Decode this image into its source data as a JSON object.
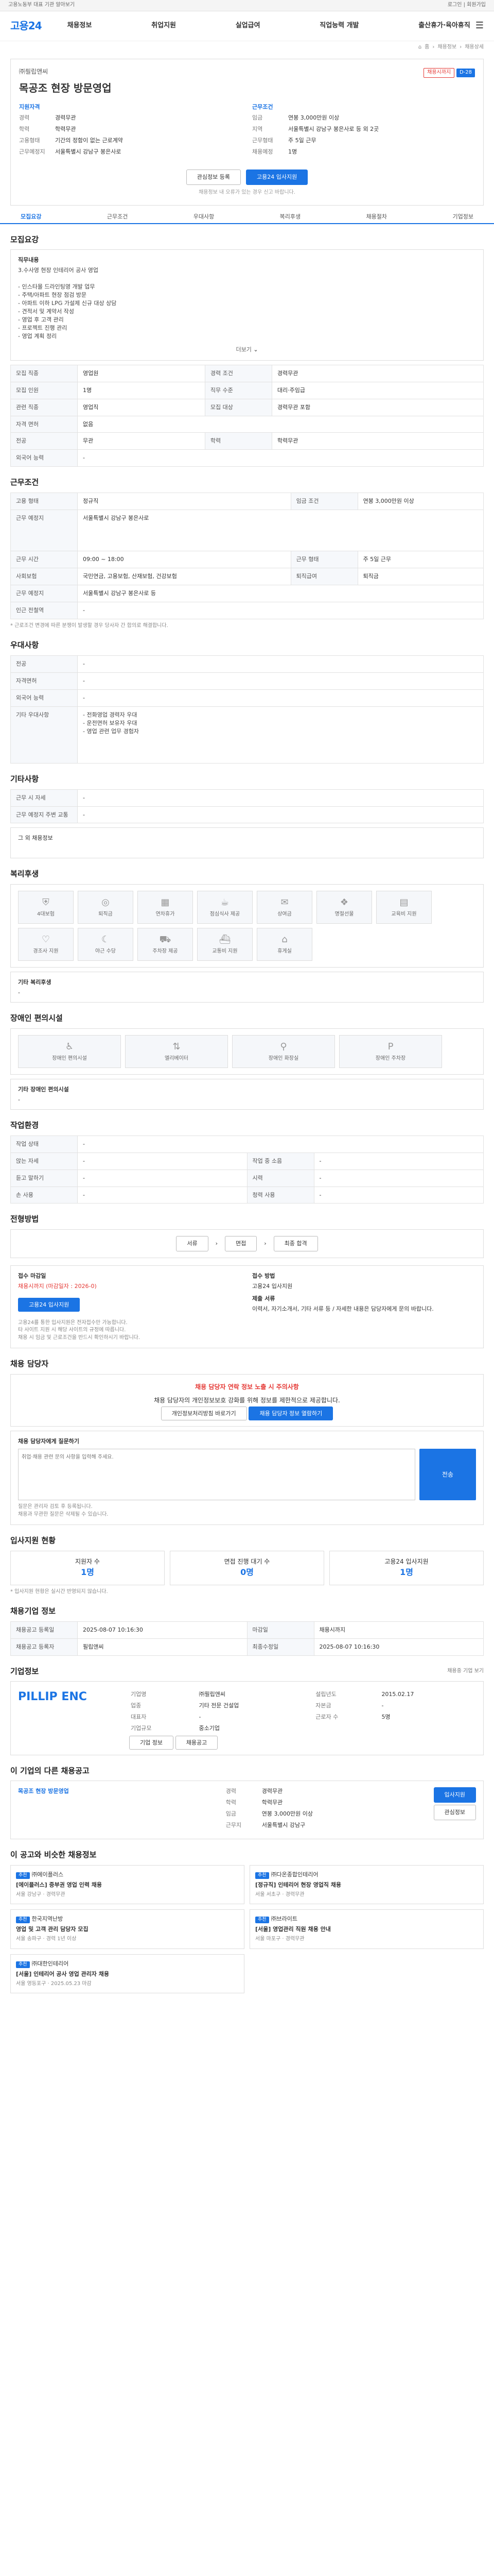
{
  "topbar": {
    "left": "고용노동부 대표 기관 알아보기",
    "right": "로그인 | 회원가입"
  },
  "logo": {
    "text": "고용24"
  },
  "gnb": [
    "채용정보",
    "취업지원",
    "실업급여",
    "직업능력 개발",
    "출산휴가·육아휴직"
  ],
  "breadcrumb": [
    "홈",
    "채용정보",
    "채용상세"
  ],
  "tabs": [
    "모집요강",
    "근무조건",
    "우대사항",
    "복리후생",
    "채용절차",
    "기업정보"
  ],
  "job": {
    "badge_dday": "D-28",
    "badge_status": "채용시까지",
    "company": "㈜필립앤씨",
    "title": "목공조 현장 방문영업",
    "summary_left_head": "지원자격",
    "summary_right_head": "근무조건",
    "left": [
      {
        "k": "경력",
        "v": "경력무관"
      },
      {
        "k": "학력",
        "v": "학력무관"
      },
      {
        "k": "고용형태",
        "v": "기간의 정함이 없는 근로계약"
      },
      {
        "k": "근무예정지",
        "v": "서울특별시 강남구 봉은사로"
      }
    ],
    "right": [
      {
        "k": "임금",
        "v": "연봉 3,000만원 이상"
      },
      {
        "k": "지역",
        "v": "서울특별시 강남구 봉은사로 등 외 2곳"
      },
      {
        "k": "근무형태",
        "v": "주 5일 근무"
      },
      {
        "k": "채용예정",
        "v": "1명"
      }
    ],
    "btn_scrap": "관심정보 등록",
    "btn_apply": "고용24 입사지원",
    "notice": "채용정보 내 오류가 있는 경우 신고 바랍니다."
  },
  "recruit": {
    "head": "모집요강",
    "sub": "직무내용",
    "desc": "3.수사영 현장 인테리어 공사 영업\n\n- 인스타몰 드라인팅영 개발 업무\n- 주택/아파트 현장 점검 방문\n- 아파트 이하 LPG 가설제 신규 대상 상담\n- 견적서 및 계약서 작성\n- 영업 후 고객 관리\n- 프로젝트 진행 관리\n- 영업 계획 정리",
    "more": "더보기",
    "rows": [
      [
        "모집 직종",
        "영업원",
        "경력 조건",
        "경력무관"
      ],
      [
        "모집 인원",
        "1명",
        "직무 수준",
        "대리·주임급"
      ],
      [
        "관련 직종",
        "영업직",
        "모집 대상",
        "경력무관 포함"
      ],
      [
        "자격 면허",
        "없음",
        "",
        ""
      ],
      [
        "전공",
        "무관",
        "학력",
        "학력무관"
      ],
      [
        "외국어 능력",
        "-",
        "",
        ""
      ]
    ]
  },
  "work": {
    "head": "근무조건",
    "rows": [
      [
        "고용 형태",
        "정규직",
        "임금 조건",
        "연봉 3,000만원 이상"
      ],
      [
        "근무 예정지",
        "서울특별시 강남구 봉은사로",
        "",
        ""
      ],
      [
        "근무 시간",
        "09:00 ~ 18:00",
        "근무 형태",
        "주 5일 근무"
      ],
      [
        "사회보험",
        "국민연금, 고용보험, 산재보험, 건강보험",
        "퇴직급여",
        "퇴직금"
      ],
      [
        "근무 예정지",
        "서울특별시 강남구 봉은사로 등",
        "",
        ""
      ],
      [
        "인근 전철역",
        "-",
        "",
        ""
      ]
    ],
    "footnote": "* 근로조건 변경에 따른 분쟁이 발생할 경우 당사자 간 합의로 해결합니다."
  },
  "pref": {
    "head": "우대사항",
    "rows": [
      [
        "전공",
        "-"
      ],
      [
        "자격면허",
        "-"
      ],
      [
        "외국어 능력",
        "-"
      ],
      [
        "기타 우대사항",
        "- 전화영업 경력자 우대\n- 운전면허 보유자 우대\n- 영업 관련 업무 경험자"
      ]
    ]
  },
  "etc": {
    "head": "기타사항",
    "rows": [
      [
        "근무 시 자세",
        "-"
      ],
      [
        "근무 예정지 주변 교통",
        "-"
      ]
    ],
    "note": "그 외 채용정보"
  },
  "welfare": {
    "head": "복리후생",
    "items": [
      "4대보험",
      "퇴직금",
      "연차휴가",
      "점심식사 제공",
      "상여금",
      "명절선물",
      "교육비 지원",
      "경조사 지원",
      "야근 수당",
      "주차장 제공",
      "교통비 지원",
      "휴게실"
    ],
    "etc_label": "기타 복리후생",
    "etc_value": "-"
  },
  "disability": {
    "head": "장애인 편의시설",
    "items": [
      "장애인 편의시설",
      "엘리베이터",
      "장애인 화장실",
      "장애인 주차장"
    ],
    "etc_label": "기타 장애인 편의시설",
    "etc_value": "-"
  },
  "place": {
    "head": "작업환경",
    "rows": [
      [
        "작업 상태",
        "-",
        "",
        ""
      ],
      [
        "앉는 자세",
        "-",
        "작업 중 소음",
        "-"
      ],
      [
        "듣고 말하기",
        "-",
        "시력",
        "-"
      ],
      [
        "손 사용",
        "-",
        "청력 사용",
        "-"
      ]
    ]
  },
  "process": {
    "head": "전형방법",
    "steps": [
      "서류",
      "면접",
      "최종 합격"
    ]
  },
  "apply": {
    "head_doc": "접수 마감일",
    "deadline": "채용시까지 (마감일자 : 2026-0)",
    "head_method": "접수 방법",
    "method": "고용24 입사지원",
    "head_docs": "제출 서류",
    "docs": "이력서, 자기소개서, 기타 서류 등 / 자세한 내용은 담당자에게 문의 바랍니다.",
    "btn": "고용24 입사지원",
    "notes": [
      "고용24를 통한 입사지원은 전자접수만 가능합니다.",
      "타 사이트 지원 시 해당 사이트의 규정에 따릅니다.",
      "채용 시 임금 및 근로조건을 반드시 확인하시기 바랍니다."
    ]
  },
  "contact": {
    "head": "채용 담당자",
    "warn": "채용 담당자 연락 정보 노출 시 주의사항",
    "text": "채용 담당자의 개인정보보호 강화를 위해 정보를 제한적으로 제공합니다.",
    "btn1": "개인정보처리방침 바로가기",
    "btn2": "채용 담당자 정보 열람하기",
    "q_label": "채용 담당자에게 질문하기",
    "placeholder": "취업·채용 관련 문의 사항을 입력해 주세요.",
    "q_btn": "전송",
    "q_notes": [
      "질문은 관리자 검토 후 등록됩니다.",
      "채용과 무관한 질문은 삭제될 수 있습니다."
    ]
  },
  "stats": {
    "head": "입사지원 현황",
    "items": [
      {
        "k": "지원자 수",
        "v": "1명"
      },
      {
        "k": "면접 진행 대기 수",
        "v": "0명"
      },
      {
        "k": "고용24 입사지원",
        "v": "1명"
      }
    ],
    "note": "* 입사지원 현황은 실시간 반영되지 않습니다."
  },
  "info": {
    "head": "채용기업 정보",
    "rows": [
      [
        "채용공고 등록일",
        "2025-08-07 10:16:30",
        "마감일",
        "채용시까지"
      ],
      [
        "채용공고 등록자",
        "필립앤씨",
        "최종수정일",
        "2025-08-07 10:16:30"
      ]
    ]
  },
  "company": {
    "head": "기업정보",
    "logo": "PILLIP ENC",
    "btn1": "기업 정보",
    "btn2": "채용공고",
    "rows": [
      [
        "기업명",
        "㈜필립앤씨",
        "설립년도",
        "2015.02.17"
      ],
      [
        "업종",
        "기타 전문 건설업",
        "자본금",
        "-"
      ],
      [
        "대표자",
        "-",
        "근로자 수",
        "5명"
      ],
      [
        "기업규모",
        "중소기업",
        "",
        ""
      ]
    ],
    "more": "채용중 기업 보기"
  },
  "similar": {
    "head": "이 기업의 다른 채용공고",
    "title": "목공조 현장 방문영업",
    "items": [
      {
        "k": "경력",
        "v": "경력무관"
      },
      {
        "k": "학력",
        "v": "학력무관"
      },
      {
        "k": "임금",
        "v": "연봉 3,000만원 이상"
      },
      {
        "k": "근무지",
        "v": "서울특별시 강남구"
      }
    ],
    "btn": "입사지원",
    "btn2": "관심정보"
  },
  "recommend": {
    "head": "이 공고와 비슷한 채용정보",
    "cards": [
      {
        "tag": "추천",
        "company": "㈜에이플러스",
        "title": "[에이플러스] 중부권 영업 인력 채용",
        "meta": "서울 강남구 · 경력무관"
      },
      {
        "tag": "추천",
        "company": "㈜다온종합인테리어",
        "title": "[정규직] 인테리어 현장 영업직 채용",
        "meta": "서울 서초구 · 경력무관"
      },
      {
        "tag": "추천",
        "company": "한국지역난방",
        "title": "영업 및 고객 관리 담당자 모집",
        "meta": "서울 송파구 · 경력 1년 이상"
      },
      {
        "tag": "추천",
        "company": "㈜브라이트",
        "title": "[서울] 영업관리 직원 채용 안내",
        "meta": "서울 마포구 · 경력무관"
      },
      {
        "tag": "추천",
        "company": "㈜대한인테리어",
        "title": "[서울] 인테리어 공사 영업 관리자 채용",
        "meta": "서울 영등포구 · 2025.05.23 마감"
      }
    ]
  }
}
